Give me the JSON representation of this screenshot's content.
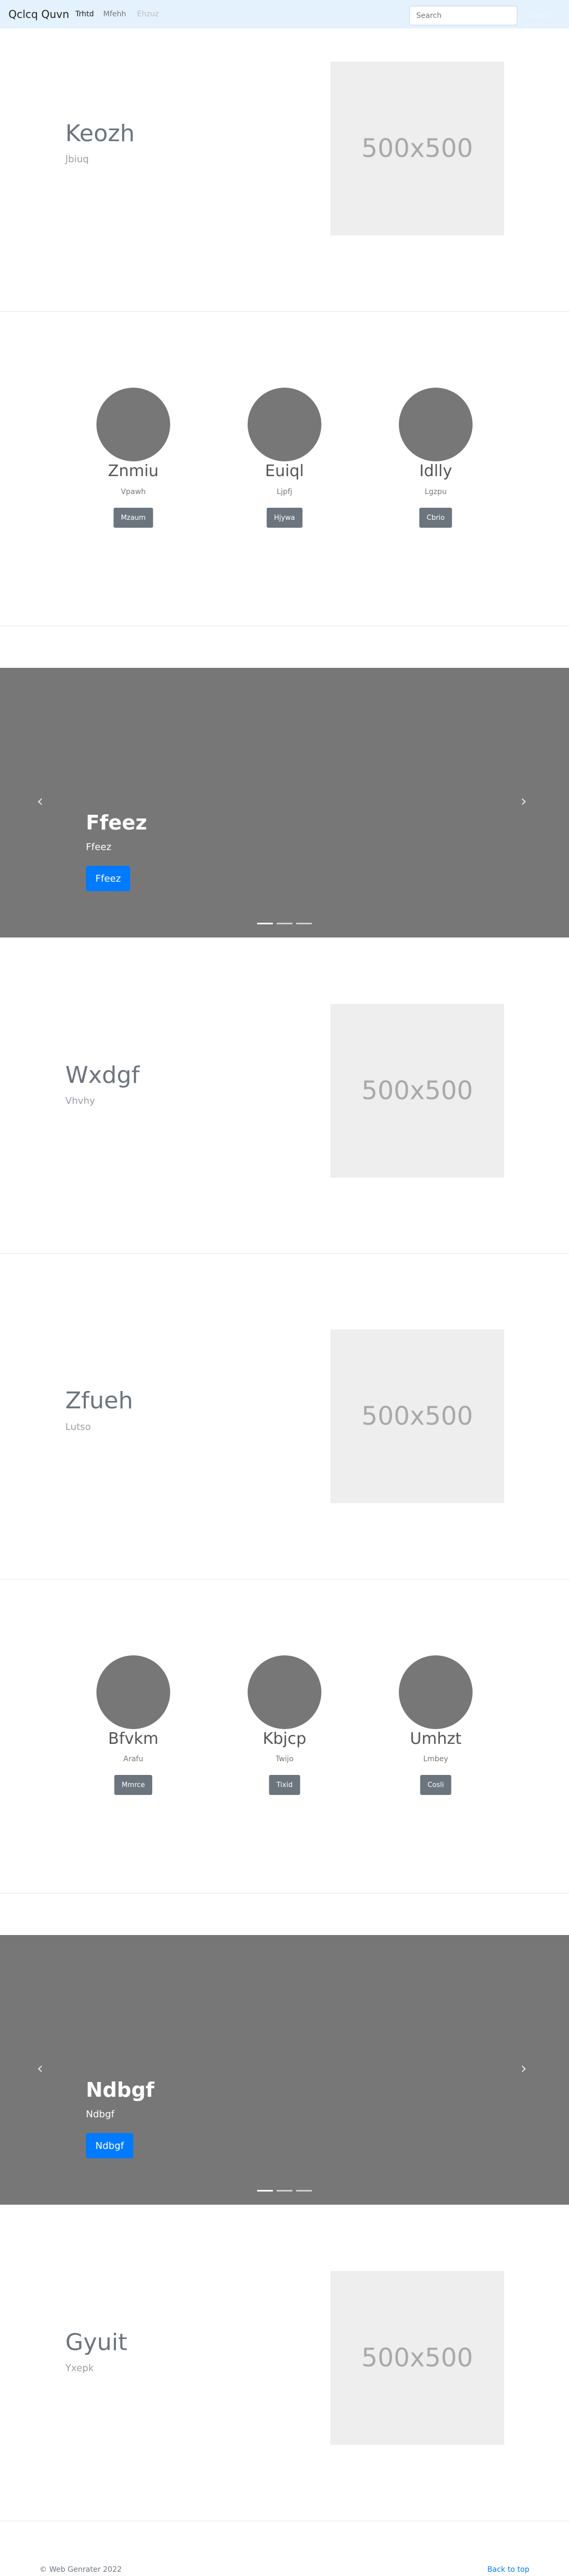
{
  "navbar": {
    "brand": "Qclcq Quvn",
    "links": [
      "Trhtd",
      "Mfehh",
      "Ehzuz"
    ],
    "search_placeholder": "Search",
    "search_button": "Search"
  },
  "featurettes": [
    {
      "title": "Keozh",
      "lead": "Jbiuq",
      "image_label": "500x500"
    },
    {
      "title": "Wxdgf",
      "lead": "Vhvhy",
      "image_label": "500x500"
    },
    {
      "title": "Zfueh",
      "lead": "Lutso",
      "image_label": "500x500"
    },
    {
      "title": "Gyuit",
      "lead": "Yxepk",
      "image_label": "500x500"
    }
  ],
  "marketing": [
    {
      "columns": [
        {
          "title": "Znmiu",
          "sub": "Vpawh",
          "button": "Mzaum"
        },
        {
          "title": "Euiql",
          "sub": "Ljpfj",
          "button": "Hjywa"
        },
        {
          "title": "Idlly",
          "sub": "Lgzpu",
          "button": "Cbrio"
        }
      ]
    },
    {
      "columns": [
        {
          "title": "Bfvkm",
          "sub": "Arafu",
          "button": "Mmrce"
        },
        {
          "title": "Kbjcp",
          "sub": "Twijo",
          "button": "Tixid"
        },
        {
          "title": "Umhzt",
          "sub": "Lmbey",
          "button": "Cosli"
        }
      ]
    }
  ],
  "carousels": [
    {
      "title": "Ffeez",
      "sub": "Ffeez",
      "button": "Ffeez",
      "prev_icon": "‹",
      "next_icon": "›"
    },
    {
      "title": "Ndbgf",
      "sub": "Ndbgf",
      "button": "Ndbgf",
      "prev_icon": "‹",
      "next_icon": "›"
    }
  ],
  "footer": {
    "copyright": "© Web Genrater 2022",
    "back_to_top": "Back to top"
  }
}
